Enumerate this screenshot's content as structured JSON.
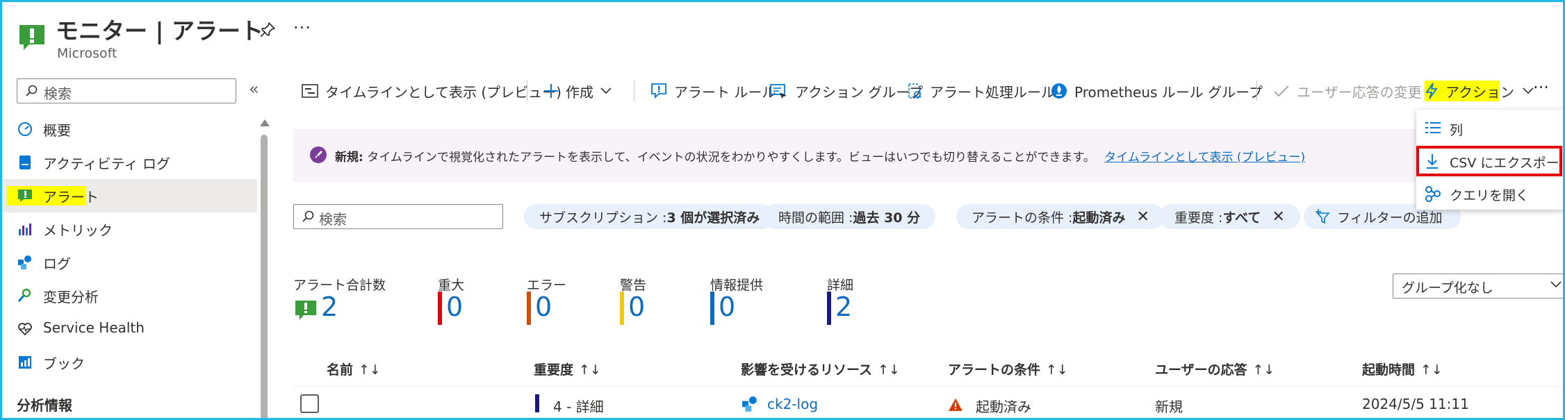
{
  "header": {
    "title": "モニター | アラート",
    "subtitle": "Microsoft"
  },
  "sidebar": {
    "search_placeholder": "検索",
    "items": [
      {
        "label": "概要",
        "icon": "overview-icon"
      },
      {
        "label": "アクティビティ ログ",
        "icon": "activity-log-icon"
      },
      {
        "label": "アラート",
        "icon": "alert-icon",
        "active": true
      },
      {
        "label": "メトリック",
        "icon": "metrics-icon"
      },
      {
        "label": "ログ",
        "icon": "logs-icon"
      },
      {
        "label": "変更分析",
        "icon": "change-analysis-icon"
      },
      {
        "label": "Service Health",
        "icon": "heart-icon"
      },
      {
        "label": "ブック",
        "icon": "workbook-icon"
      }
    ],
    "section_heading": "分析情報"
  },
  "toolbar": {
    "timeline": "タイムラインとして表示 (プレビュー)",
    "create": "作成",
    "alert_rules": "アラート ルール",
    "action_groups": "アクション グループ",
    "processing_rules": "アラート処理ルール",
    "prometheus": "Prometheus ルール グループ",
    "user_response": "ユーザー応答の変更",
    "actions": "アクション"
  },
  "banner": {
    "bold": "新規:",
    "text": "タイムラインで視覚化されたアラートを表示して、イベントの状況をわかりやすくします。ビューはいつでも切り替えることができます。",
    "link": "タイムラインとして表示 (プレビュー)"
  },
  "actions_menu": {
    "items": [
      {
        "label": "列",
        "icon": "columns-icon"
      },
      {
        "label": "CSV にエクスポート",
        "icon": "download-icon"
      },
      {
        "label": "クエリを開く",
        "icon": "query-icon"
      }
    ]
  },
  "filters": {
    "search_placeholder": "検索",
    "pills": [
      {
        "key": "サブスクリプション : ",
        "value": "3 個が選択済み"
      },
      {
        "key": "時間の範囲 : ",
        "value": "過去 30 分"
      },
      {
        "key": "アラートの条件 : ",
        "value": "起動済み"
      },
      {
        "key": "重要度 : ",
        "value": "すべて"
      }
    ],
    "add_filter": "フィルターの追加"
  },
  "summary": {
    "total_label": "アラート合計数",
    "total_value": "2",
    "critical_label": "重大",
    "critical_value": "0",
    "error_label": "エラー",
    "error_value": "0",
    "warning_label": "警告",
    "warning_value": "0",
    "info_label": "情報提供",
    "info_value": "0",
    "verbose_label": "詳細",
    "verbose_value": "2",
    "colors": {
      "critical": "#e3000f",
      "error": "#ca5010",
      "warning": "#f2c811",
      "info": "#0f6cbd",
      "verbose": "#1c1a7a"
    }
  },
  "grouping": {
    "selected": "グループ化なし"
  },
  "table": {
    "columns": [
      "名前",
      "重要度",
      "影響を受けるリソース",
      "アラートの条件",
      "ユーザーの応答",
      "起動時間"
    ],
    "sort_glyph": "↑↓",
    "rows": [
      {
        "name": "",
        "severity": "4 - 詳細",
        "resource": "ck2-log",
        "condition": "起動済み",
        "response": "新規",
        "time": "2024/5/5 11:11"
      }
    ]
  }
}
